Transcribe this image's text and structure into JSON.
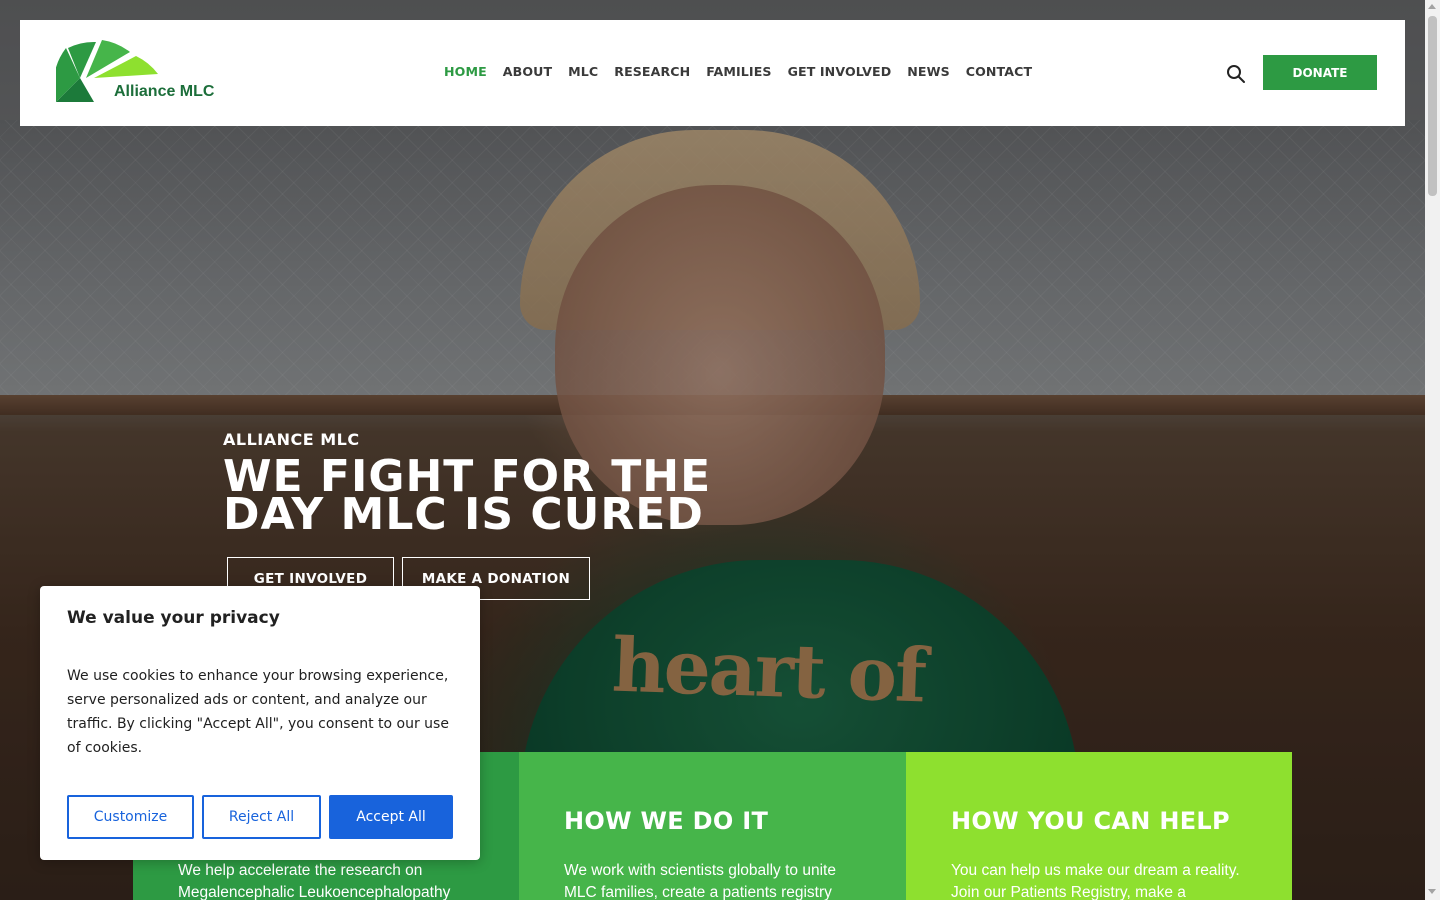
{
  "header": {
    "logo_text": "Alliance MLC",
    "nav": [
      {
        "label": "HOME",
        "active": true
      },
      {
        "label": "ABOUT",
        "active": false
      },
      {
        "label": "MLC",
        "active": false
      },
      {
        "label": "RESEARCH",
        "active": false
      },
      {
        "label": "FAMILIES",
        "active": false
      },
      {
        "label": "GET INVOLVED",
        "active": false
      },
      {
        "label": "NEWS",
        "active": false
      },
      {
        "label": "CONTACT",
        "active": false
      }
    ],
    "search_icon": "search-icon",
    "donate_label": "DONATE"
  },
  "hero": {
    "eyebrow": "ALLIANCE MLC",
    "title_line1": "WE FIGHT FOR THE",
    "title_line2": "DAY MLC IS CURED",
    "btn_get_involved": "GET INVOLVED",
    "btn_donation": "MAKE A DONATION",
    "shirt_text": "heart of"
  },
  "cards": [
    {
      "title": "",
      "text": "We help accelerate the research on Megalencephalic Leukoencephalopathy"
    },
    {
      "title": "HOW WE DO IT",
      "text": "We work with scientists globally to unite MLC families, create a patients registry"
    },
    {
      "title": "HOW YOU CAN HELP",
      "text": "You can help us make our dream a reality. Join our Patients Registry, make a"
    }
  ],
  "cookie": {
    "title": "We value your privacy",
    "body": "We use cookies to enhance your browsing experience, serve personalized ads or content, and analyze our traffic. By clicking \"Accept All\", you consent to our use of cookies.",
    "customize": "Customize",
    "reject": "Reject All",
    "accept": "Accept All"
  },
  "colors": {
    "brand_green": "#2d9a43",
    "mid_green": "#46b54a",
    "lime_green": "#8ee02f",
    "cookie_blue": "#1863dc"
  }
}
